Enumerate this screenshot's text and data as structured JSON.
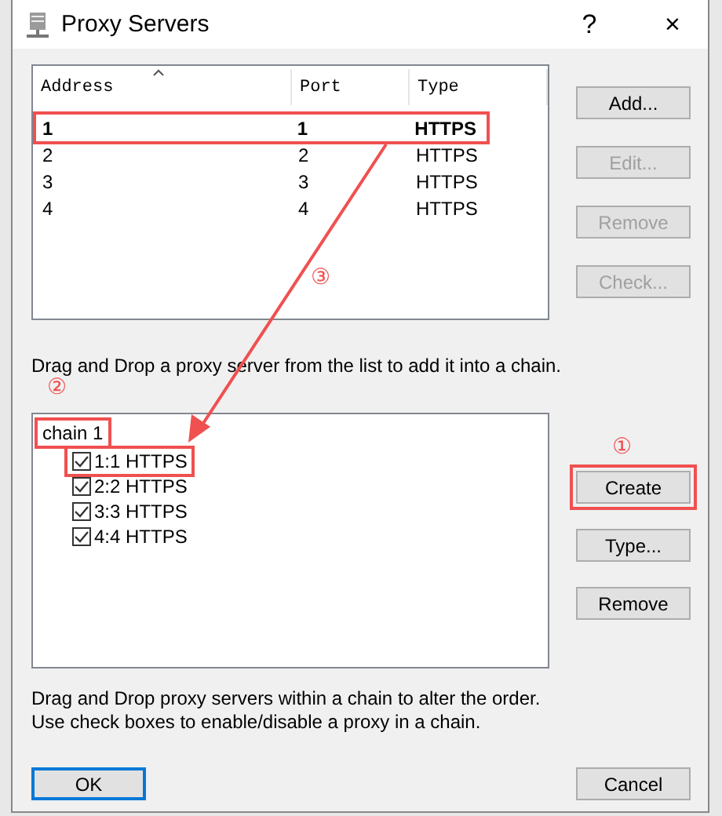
{
  "window": {
    "title": "Proxy Servers",
    "controls": [
      "?",
      "×"
    ]
  },
  "server_table": {
    "columns": [
      {
        "label": "Address",
        "sorted": true
      },
      {
        "label": "Port",
        "sorted": false
      },
      {
        "label": "Type",
        "sorted": false
      }
    ],
    "rows": [
      {
        "cells": [
          "1",
          "1",
          "HTTPS"
        ],
        "active": true,
        "highlighted": true
      },
      {
        "cells": [
          "2",
          "2",
          "HTTPS"
        ],
        "active": false,
        "highlighted": false
      },
      {
        "cells": [
          "3",
          "3",
          "HTTPS"
        ],
        "active": false,
        "highlighted": false
      },
      {
        "cells": [
          "4",
          "4",
          "HTTPS"
        ],
        "active": false,
        "highlighted": false
      }
    ]
  },
  "server_buttons": [
    {
      "label": "Add...",
      "disabled": false
    },
    {
      "label": "Edit...",
      "disabled": true
    },
    {
      "label": "Remove",
      "disabled": true
    },
    {
      "label": "Check...",
      "disabled": true
    }
  ],
  "drag_hint": "Drag and Drop a proxy server from the list to add it into a chain.",
  "chain": {
    "name": "chain 1",
    "highlighted": true,
    "marker": "②",
    "items": [
      {
        "label": "1:1 HTTPS",
        "checked": true,
        "highlighted": true
      },
      {
        "label": "2:2 HTTPS",
        "checked": true,
        "highlighted": false
      },
      {
        "label": "3:3 HTTPS",
        "checked": true,
        "highlighted": false
      },
      {
        "label": "4:4 HTTPS",
        "checked": true,
        "highlighted": false
      }
    ]
  },
  "chain_buttons": [
    {
      "label": "Create",
      "highlighted": true,
      "marker": "①"
    },
    {
      "label": "Type...",
      "highlighted": false
    },
    {
      "label": "Remove",
      "highlighted": false
    }
  ],
  "arrow_marker": "③",
  "footer_hints": [
    "Drag and Drop proxy servers within a chain to alter the order.",
    "Use check boxes to enable/disable a proxy in a chain."
  ],
  "dialog_buttons": [
    {
      "label": "OK",
      "default": true
    },
    {
      "label": "Cancel",
      "default": false
    }
  ]
}
